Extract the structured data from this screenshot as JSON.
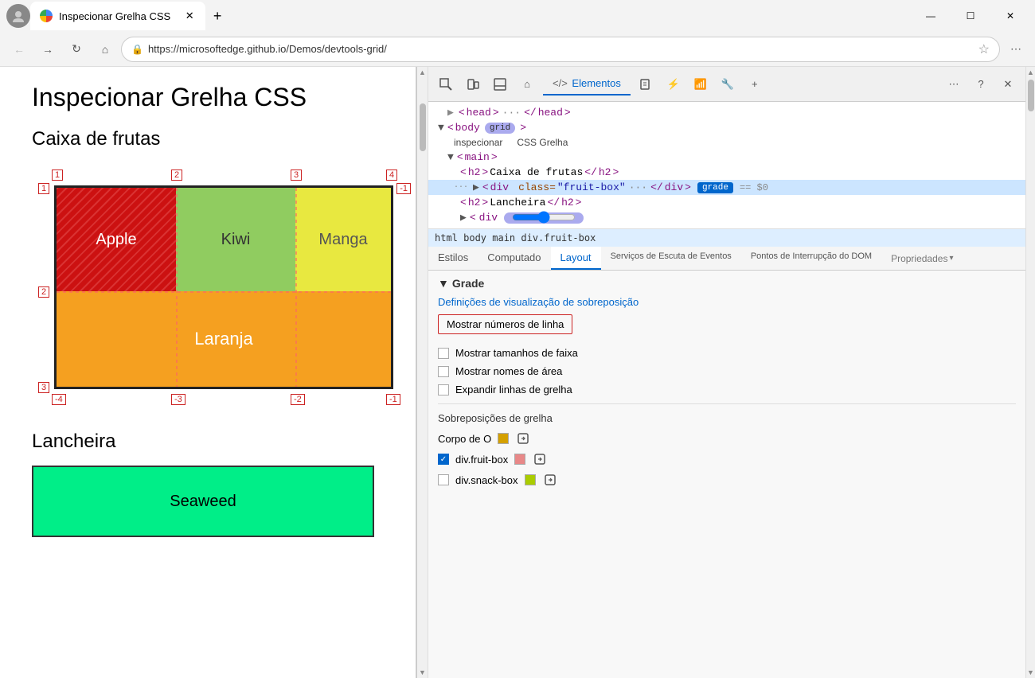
{
  "browser": {
    "tab_title": "Inspecionar Grelha CSS",
    "url": "https://microsoftedge.github.io/Demos/devtools-grid/",
    "window_controls": {
      "minimize": "—",
      "maximize": "☐",
      "close": "✕"
    }
  },
  "page": {
    "title": "Inspecionar Grelha CSS",
    "section1_title": "Caixa de frutas",
    "section2_title": "Lancheira",
    "fruits": {
      "apple": "Apple",
      "kiwi": "Kiwi",
      "manga": "Manga",
      "laranja": "Laranja",
      "seaweed": "Seaweed"
    },
    "grid_numbers": {
      "top": [
        "1",
        "2",
        "3",
        "4"
      ],
      "left": [
        "1",
        "2",
        "3"
      ],
      "bottom": [
        "-4",
        "-3",
        "-2",
        "-1"
      ],
      "right": [
        "-1"
      ]
    }
  },
  "devtools": {
    "tabs": {
      "elementos": "Elementos",
      "active": "Elementos"
    },
    "toolbar_icons": [
      "device-icon",
      "layers-icon",
      "box-icon",
      "home-icon",
      "code-icon",
      "sources-icon",
      "bug-icon",
      "wifi-icon",
      "settings-icon",
      "plus-icon",
      "more-icon",
      "help-icon",
      "close-icon"
    ],
    "dom": {
      "lines": [
        {
          "indent": 1,
          "html": "<head> ··· </head>"
        },
        {
          "indent": 1,
          "html": "▼ < body  grid",
          "badge": true
        },
        {
          "indent": 3,
          "label": "inspecionar",
          "label2": "CSS Grelha"
        },
        {
          "indent": 2,
          "html": "▼ <main>"
        },
        {
          "indent": 3,
          "html": "<h2>Caixa de frutas</h2>"
        },
        {
          "indent": 3,
          "html": "▶ <div   class=\"fruit-box\"> ··· </div>",
          "badge2": "grade",
          "ref": "== $0",
          "selected": true
        },
        {
          "indent": 4,
          "html": "<h2>Lancheira</h2>"
        },
        {
          "indent": 4,
          "html": "▶ <div  grid",
          "has_slider": true
        }
      ]
    },
    "breadcrumb": "html body main div.fruit-box",
    "styles_tabs": [
      "Estilos",
      "Computado",
      "Layout",
      "Serviços de Escuta de Eventos",
      "Pontos de Interrupção do DOM",
      "Propriedades"
    ],
    "layout": {
      "grade_title": "Grade",
      "overlay_title": "Definições de visualização de sobreposição",
      "options": {
        "mostrar_numeros": "Mostrar números de linha",
        "mostrar_tamanhos": "Mostrar tamanhos de faixa",
        "mostrar_nomes": "Mostrar nomes de área",
        "expandir_linhas": "Expandir linhas de grelha"
      },
      "sobreposicoes_title": "Sobreposições de grelha",
      "overlays": [
        {
          "label": "Corpo de O",
          "color": "#d4a000",
          "checked": false,
          "name": "corpo"
        },
        {
          "label": "div.fruit-box",
          "color": "#e88",
          "checked": true,
          "name": "fruit-box"
        },
        {
          "label": "div.snack-box",
          "color": "#aacc00",
          "checked": false,
          "name": "snack-box"
        }
      ]
    }
  }
}
